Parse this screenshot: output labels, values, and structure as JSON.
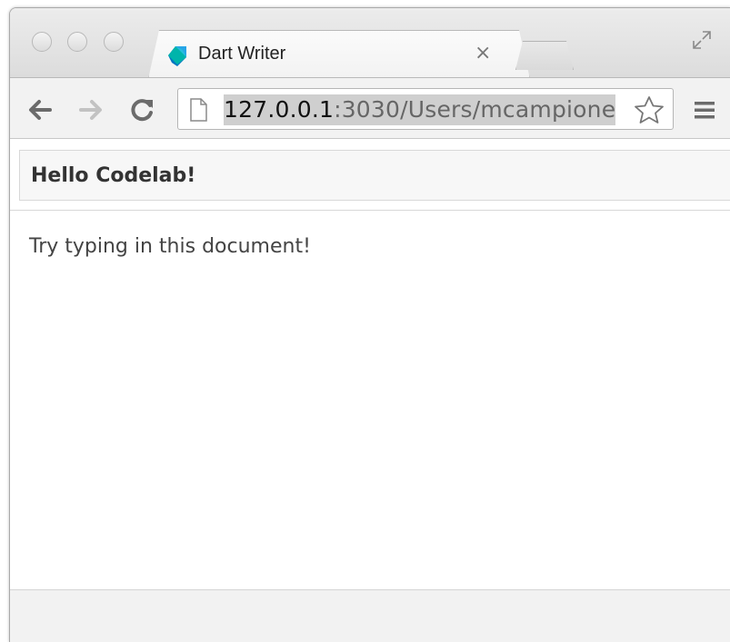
{
  "window": {
    "tab": {
      "title": "Dart Writer",
      "close_glyph": "×",
      "favicon": "dart-logo-icon"
    }
  },
  "toolbar": {
    "back": "back-arrow-icon",
    "forward": "forward-arrow-icon",
    "reload": "reload-icon",
    "url_host": "127.0.0.1",
    "url_rest": ":3030/Users/mcampione",
    "bookmark": "star-icon",
    "menu": "hamburger-menu-icon"
  },
  "page": {
    "header_title": "Hello Codelab!",
    "editor_text": "Try typing in this document!"
  },
  "colors": {
    "dart_teal": "#00b4ab",
    "dart_blue": "#0175c2",
    "toolbar_bg": "#f2f2f2"
  }
}
